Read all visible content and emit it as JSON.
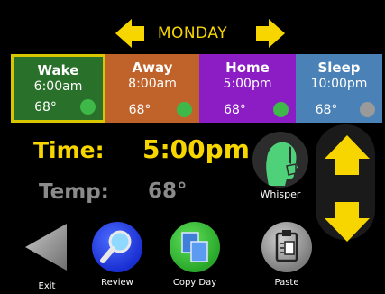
{
  "day": {
    "label": "MONDAY"
  },
  "periods": [
    {
      "name": "Wake",
      "time": "6:00am",
      "temp": "68°",
      "dot_color": "#3fb84a"
    },
    {
      "name": "Away",
      "time": "8:00am",
      "temp": "68°",
      "dot_color": "#3fb84a"
    },
    {
      "name": "Home",
      "time": "5:00pm",
      "temp": "68°",
      "dot_color": "#3fb84a"
    },
    {
      "name": "Sleep",
      "time": "10:00pm",
      "temp": "68°",
      "dot_color": "#9a9a9a"
    }
  ],
  "time": {
    "label": "Time:",
    "value": "5:00pm"
  },
  "temp": {
    "label": "Temp:",
    "value": "68°"
  },
  "whisper": {
    "label": "Whisper",
    "icon": "whisper-face-icon"
  },
  "buttons": {
    "exit": "Exit",
    "review": "Review",
    "copy_day": "Copy Day",
    "paste": "Paste"
  },
  "colors": {
    "accent": "#f7d600",
    "wake": "#29702a",
    "away": "#c0632a",
    "home": "#8c1cc4",
    "sleep": "#4a82b8"
  }
}
